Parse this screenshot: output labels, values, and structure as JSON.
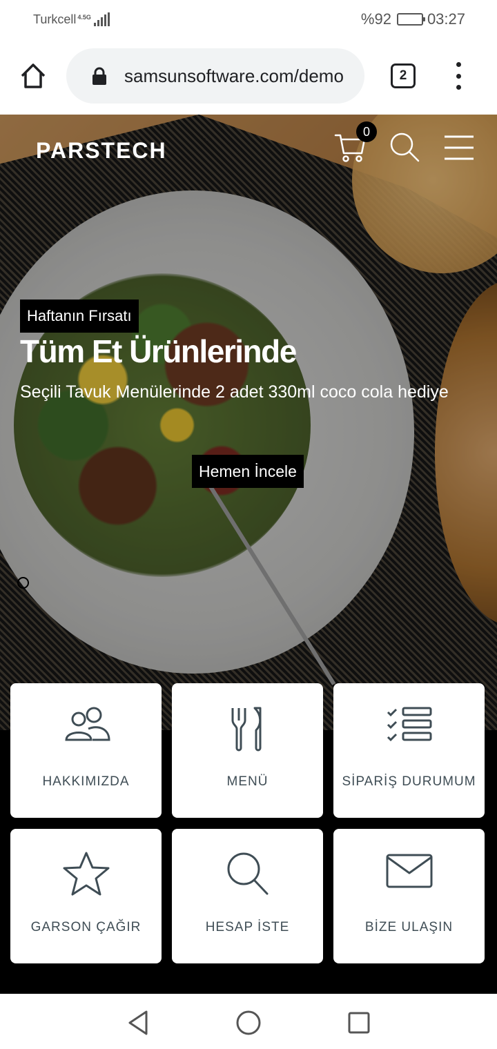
{
  "status_bar": {
    "carrier": "Turkcell",
    "network": "4.5G",
    "battery_percent": "%92",
    "battery_level": 0.92,
    "time": "03:27"
  },
  "browser": {
    "url": "samsunsoftware.com/demo",
    "tab_count": "2",
    "icons": [
      "home-icon",
      "lock-icon",
      "tabs-icon",
      "more-vert-icon"
    ]
  },
  "site": {
    "logo": "PARSTECH",
    "cart_count": "0",
    "icons": [
      "cart-icon",
      "search-icon",
      "hamburger-menu-icon"
    ]
  },
  "hero": {
    "tag": "Haftanın Fırsatı",
    "title": "Tüm Et Ürünlerinde",
    "subtitle": "Seçili Tavuk Menülerinde 2 adet 330ml coco cola hediye",
    "button": "Hemen İncele"
  },
  "tiles": [
    {
      "label": "HAKKIMIZDA",
      "icon": "users-icon"
    },
    {
      "label": "MENÜ",
      "icon": "cutlery-icon"
    },
    {
      "label": "SİPARİŞ DURUMUM",
      "icon": "checklist-icon"
    },
    {
      "label": "GARSON ÇAĞIR",
      "icon": "star-icon"
    },
    {
      "label": "HESAP İSTE",
      "icon": "search-icon"
    },
    {
      "label": "BİZE ULAŞIN",
      "icon": "mail-icon"
    }
  ],
  "nav_bar": {
    "icons": [
      "back-icon",
      "home-circle-icon",
      "recents-icon"
    ]
  },
  "colors": {
    "tile_text": "#3f4d55",
    "url_bg": "#f1f3f4"
  }
}
